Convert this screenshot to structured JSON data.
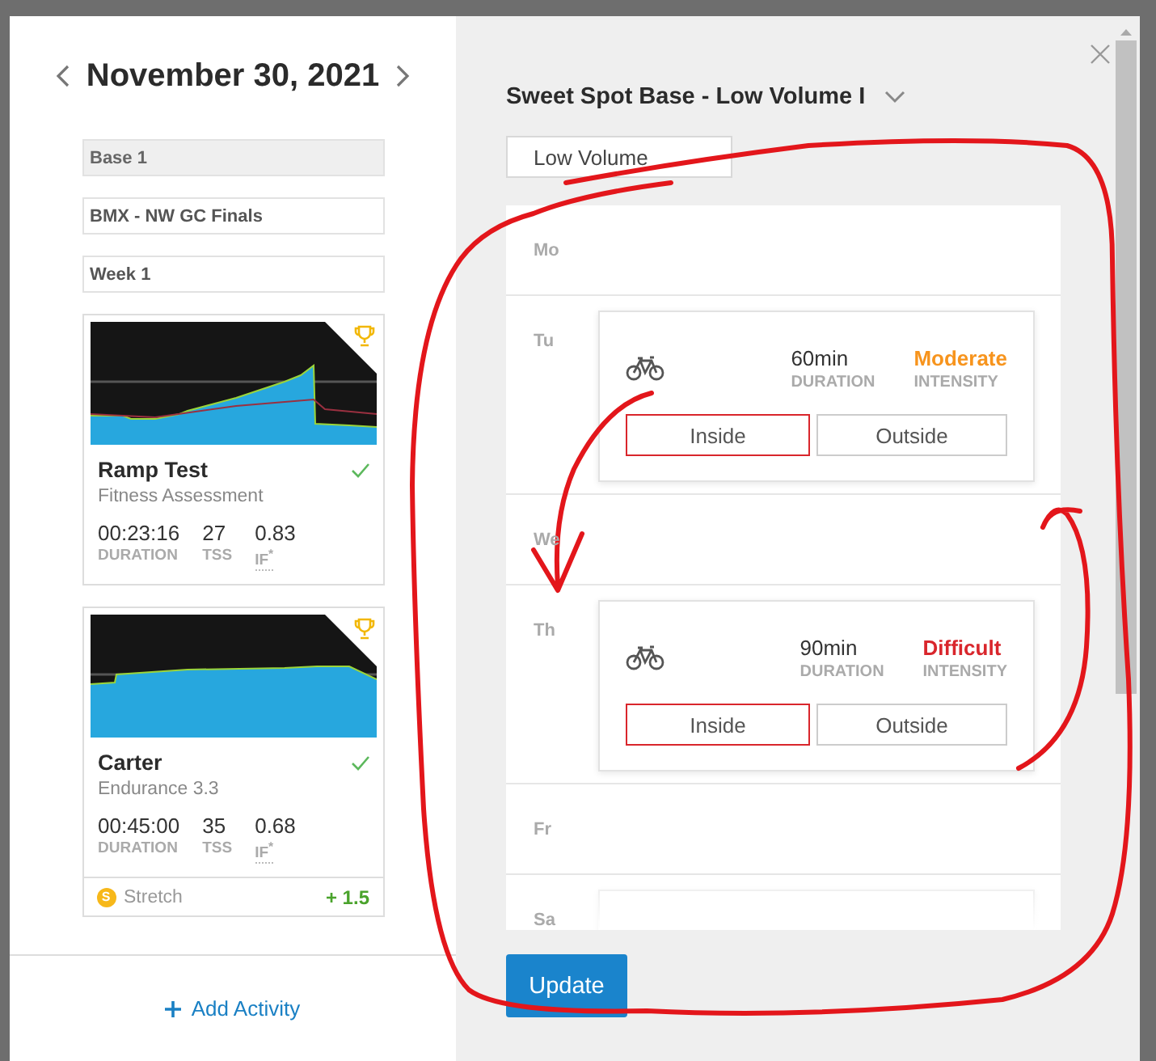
{
  "left": {
    "date": "November 30, 2021",
    "fields": [
      {
        "label": "Base 1",
        "disabled": true
      },
      {
        "label": "BMX - NW GC Finals",
        "disabled": false
      },
      {
        "label": "Week 1",
        "disabled": false
      }
    ],
    "workouts": [
      {
        "kind": "ramp",
        "name": "Ramp Test",
        "category": "Fitness Assessment",
        "completed": true,
        "stats": [
          {
            "value": "00:23:16",
            "label": "DURATION"
          },
          {
            "value": "27",
            "label": "TSS"
          },
          {
            "value": "0.83",
            "label": "IF$^{*}$"
          }
        ]
      },
      {
        "kind": "steady",
        "name": "Carter",
        "category": "Endurance 3.3",
        "completed": true,
        "stats": [
          {
            "value": "00:45:00",
            "label": "DURATION"
          },
          {
            "value": "35",
            "label": "TSS"
          },
          {
            "value": "0.68",
            "label": "IF$^{*}$"
          }
        ],
        "footer": {
          "badge": "S",
          "label": "Stretch",
          "value": "+ 1.5"
        }
      }
    ],
    "add_activity": "Add Activity"
  },
  "right": {
    "plan_title": "Sweet Spot Base - Low Volume I",
    "volume": "Low Volume",
    "days": [
      {
        "day": "Mo",
        "kind": "empty"
      },
      {
        "day": "Tu",
        "kind": "workout",
        "workout": {
          "duration": "60min",
          "duration_label": "DURATION",
          "intensity": "Moderate",
          "intensity_label": "INTENSITY",
          "color": "#f7941d",
          "buttons": [
            {
              "label": "Inside",
              "selected": true
            },
            {
              "label": "Outside",
              "selected": false
            }
          ]
        }
      },
      {
        "day": "We",
        "kind": "empty"
      },
      {
        "day": "Th",
        "kind": "workout",
        "workout": {
          "duration": "90min",
          "duration_label": "DURATION",
          "intensity": "Difficult",
          "intensity_label": "INTENSITY",
          "color": "#d9262c",
          "buttons": [
            {
              "label": "Inside",
              "selected": true
            },
            {
              "label": "Outside",
              "selected": false
            }
          ]
        }
      },
      {
        "day": "Fr",
        "kind": "empty"
      },
      {
        "day": "Sa",
        "kind": "cut"
      }
    ],
    "update": "Update"
  }
}
